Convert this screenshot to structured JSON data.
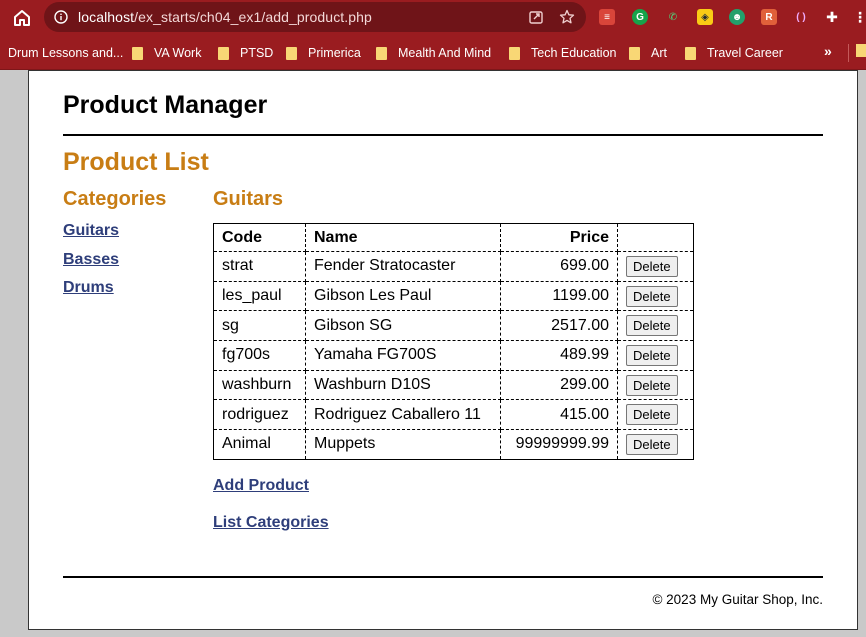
{
  "browser": {
    "url_host": "localhost",
    "url_path": "/ex_starts/ch04_ex1/add_product.php",
    "icons": [
      "home-icon",
      "info-icon",
      "share-icon",
      "star-icon",
      "todoist-icon",
      "grammarly-icon",
      "phone-icon",
      "hex-icon",
      "robot-icon",
      "readwise-icon",
      "bracket-icon",
      "puzzle-icon",
      "menu-icon"
    ],
    "bookmarks": [
      {
        "label": "Drum Lessons and..."
      },
      {
        "label": "VA Work"
      },
      {
        "label": "PTSD"
      },
      {
        "label": "Primerica"
      },
      {
        "label": "Mealth And Mind"
      },
      {
        "label": "Tech Education"
      },
      {
        "label": "Art"
      },
      {
        "label": "Travel Career"
      }
    ],
    "more": "»"
  },
  "page": {
    "site_title": "Product Manager",
    "list_title": "Product List",
    "categories_heading": "Categories",
    "categories": [
      "Guitars",
      "Basses",
      "Drums"
    ],
    "current_category": "Guitars",
    "table": {
      "headers": {
        "code": "Code",
        "name": "Name",
        "price": "Price"
      },
      "rows": [
        {
          "code": "strat",
          "name": "Fender Stratocaster",
          "price": "699.00",
          "action": "Delete"
        },
        {
          "code": "les_paul",
          "name": "Gibson Les Paul",
          "price": "1199.00",
          "action": "Delete"
        },
        {
          "code": "sg",
          "name": "Gibson SG",
          "price": "2517.00",
          "action": "Delete"
        },
        {
          "code": "fg700s",
          "name": "Yamaha FG700S",
          "price": "489.99",
          "action": "Delete"
        },
        {
          "code": "washburn",
          "name": "Washburn D10S",
          "price": "299.00",
          "action": "Delete"
        },
        {
          "code": "rodriguez",
          "name": "Rodriguez Caballero 11",
          "price": "415.00",
          "action": "Delete"
        },
        {
          "code": "Animal",
          "name": "Muppets",
          "price": "99999999.99",
          "action": "Delete"
        }
      ]
    },
    "add_product_link": "Add Product",
    "list_categories_link": "List Categories",
    "footer": "© 2023 My Guitar Shop, Inc."
  },
  "colors": {
    "chrome": "#9a1c20",
    "heading_accent": "#c87d14",
    "link": "#2e3e7a"
  }
}
